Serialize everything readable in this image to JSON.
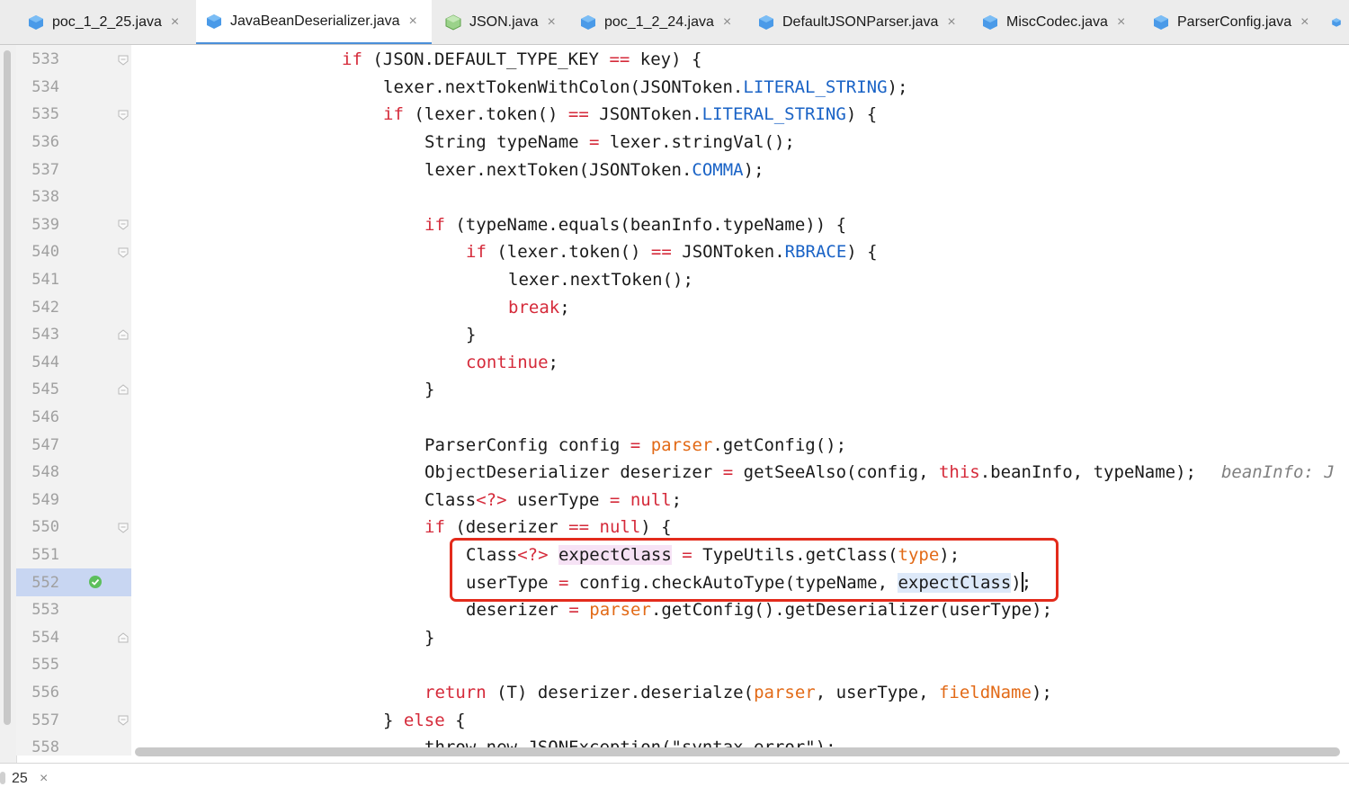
{
  "tabs": [
    {
      "label": "poc_1_2_25.java",
      "icon": "java-class-icon"
    },
    {
      "label": "JavaBeanDeserializer.java",
      "icon": "java-class-icon"
    },
    {
      "label": "JSON.java",
      "icon": "java-class-icon"
    },
    {
      "label": "poc_1_2_24.java",
      "icon": "java-class-icon"
    },
    {
      "label": "DefaultJSONParser.java",
      "icon": "java-class-icon"
    },
    {
      "label": "MiscCodec.java",
      "icon": "java-class-icon"
    },
    {
      "label": "ParserConfig.java",
      "icon": "java-class-icon"
    }
  ],
  "close_glyph": "×",
  "line_numbers": [
    "533",
    "534",
    "535",
    "536",
    "537",
    "538",
    "539",
    "540",
    "541",
    "542",
    "543",
    "544",
    "545",
    "546",
    "547",
    "548",
    "549",
    "550",
    "551",
    "552",
    "553",
    "554",
    "555",
    "556",
    "557",
    "558"
  ],
  "code": {
    "l533": {
      "a": "if",
      "b": " (JSON.DEFAULT_TYPE_KEY ",
      "c": "==",
      "d": " key) {"
    },
    "l534": {
      "a": "lexer.nextTokenWithColon(JSONToken.",
      "b": "LITERAL_STRING",
      "c": ");"
    },
    "l535": {
      "a": "if",
      "b": " (lexer.token() ",
      "c": "==",
      "d": " JSONToken.",
      "e": "LITERAL_STRING",
      "f": ") {"
    },
    "l536": {
      "a": "String typeName ",
      "b": "=",
      "c": " lexer.stringVal();"
    },
    "l537": {
      "a": "lexer.nextToken(JSONToken.",
      "b": "COMMA",
      "c": ");"
    },
    "l539": {
      "a": "if",
      "b": " (typeName.equals(beanInfo.typeName)) {"
    },
    "l540": {
      "a": "if",
      "b": " (lexer.token() ",
      "c": "==",
      "d": " JSONToken.",
      "e": "RBRACE",
      "f": ") {"
    },
    "l541": {
      "a": "lexer.nextToken();"
    },
    "l542": {
      "a": "break",
      "b": ";"
    },
    "l543": {
      "a": "}"
    },
    "l544": {
      "a": "continue",
      "b": ";"
    },
    "l545": {
      "a": "}"
    },
    "l547": {
      "a": "ParserConfig config ",
      "b": "=",
      "c": " ",
      "d": "parser",
      "e": ".getConfig();"
    },
    "l548": {
      "a": "ObjectDeserializer deserizer ",
      "b": "=",
      "c": " getSeeAlso(config, ",
      "d": "this",
      "e": ".beanInfo, typeName);",
      "f": "beanInfo: J"
    },
    "l549": {
      "a": "Class",
      "b": "<?>",
      "c": " userType ",
      "d": "=",
      "e": " ",
      "f": "null",
      "g": ";"
    },
    "l550": {
      "a": "if",
      "b": " (deserizer ",
      "c": "==",
      "d": " ",
      "e": "null",
      "f": ") {"
    },
    "l551": {
      "a": "Class",
      "b": "<?>",
      "c": " ",
      "d": "expectClass",
      "e": " ",
      "f": "=",
      "g": " TypeUtils.getClass(",
      "h": "type",
      "i": ");"
    },
    "l552": {
      "a": "userType ",
      "b": "=",
      "c": " config.checkAutoType(typeName, ",
      "d": "expectClass",
      "e": ");"
    },
    "l553": {
      "a": "deserizer ",
      "b": "=",
      "c": " ",
      "d": "parser",
      "e": ".getConfig().getDeserializer(userType);"
    },
    "l554": {
      "a": "}"
    },
    "l556": {
      "a": "return",
      "b": " (T) deserizer.deserialze(",
      "c": "parser",
      "d": ", userType, ",
      "e": "fieldName",
      "f": ");"
    },
    "l557": {
      "a": "} ",
      "b": "else",
      "c": " {"
    },
    "l558": {
      "a": "throw new JSONException(\"syntax error\");"
    }
  },
  "bottom": {
    "label": "25",
    "close": "×"
  },
  "colors": {
    "keyword": "#d52a3a",
    "constant": "#1a63c6",
    "param": "#e26a17",
    "highlight": "#c8d6f2",
    "annotation": "#e32b1c"
  }
}
